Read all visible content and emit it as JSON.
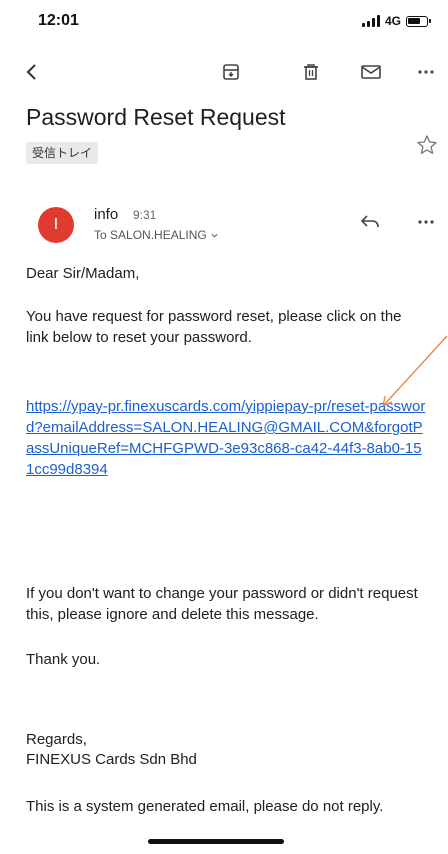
{
  "status_bar": {
    "time": "12:01",
    "network": "4G"
  },
  "toolbar": {
    "back_icon": "chevron-left-icon",
    "archive_icon": "archive-icon",
    "delete_icon": "trash-icon",
    "mail_icon": "envelope-icon",
    "more_icon": "more-horizontal-icon"
  },
  "email": {
    "subject": "Password Reset Request",
    "label": "受信トレイ",
    "sender": {
      "name": "info",
      "time": "9:31",
      "recipient": "To SALON.HEALING",
      "avatar_letter": "I",
      "avatar_color": "#e03b2e"
    },
    "body": {
      "greeting": "Dear Sir/Madam,",
      "intro": "You have request for password reset, please click on the link below to reset your password.",
      "link": "https://ypay-pr.finexuscards.com/yippiepay-pr/reset-password?emailAddress=SALON.HEALING@GMAIL.COM&forgotPassUniqueRef=MCHFGPWD-3e93c868-ca42-44f3-8ab0-151cc99d8394",
      "ignore": "If you don't want to change your password or didn't request this, please ignore and delete this message.",
      "thanks": "Thank you.",
      "regards": "Regards,",
      "company": "FINEXUS Cards Sdn Bhd",
      "disclaimer": "This is a system generated email, please do not reply."
    }
  },
  "colors": {
    "link": "#1a5fd1",
    "annotation_arrow": "#e8824a"
  }
}
